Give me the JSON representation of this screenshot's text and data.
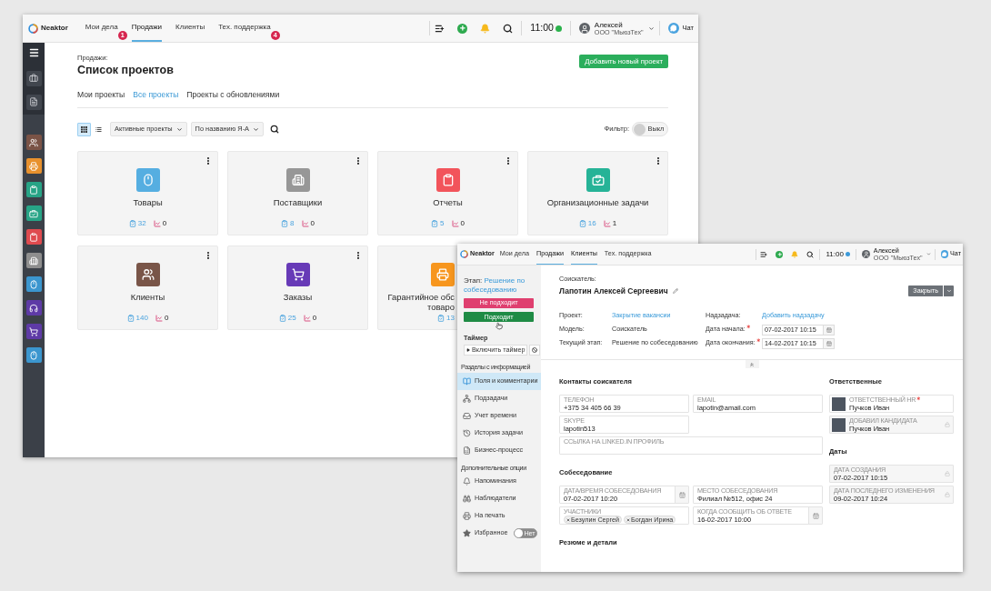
{
  "back_window": {
    "topbar": {
      "logo": "Neaktor",
      "nav": [
        {
          "label": "Мои дела",
          "selected": false,
          "badge": "1"
        },
        {
          "label": "Продажи",
          "selected": true
        },
        {
          "label": "Клиенты",
          "selected": false
        },
        {
          "label": "Тех. поддержка",
          "selected": false,
          "badge": "4"
        }
      ],
      "time": "11:00",
      "user": "Алексей",
      "company": "ООО \"МьюзТех\"",
      "chat": "Чат"
    },
    "sidebar": {
      "top": [
        {
          "kind": "menu"
        },
        {
          "kind": "briefcase"
        },
        {
          "kind": "document"
        }
      ],
      "items": [
        {
          "kind": "people",
          "color": "#7a5346"
        },
        {
          "kind": "printer",
          "color": "#e8912d"
        },
        {
          "kind": "clipboard",
          "color": "#27a486"
        },
        {
          "kind": "briefcase-check",
          "color": "#27a486"
        },
        {
          "kind": "clipboard",
          "color": "#df4a4f"
        },
        {
          "kind": "building",
          "color": "#8e8e8e"
        },
        {
          "kind": "mouse",
          "color": "#3b96cf"
        },
        {
          "kind": "headphones",
          "color": "#5e3aa6"
        },
        {
          "kind": "cart",
          "color": "#5e3aa6"
        },
        {
          "kind": "mouse",
          "color": "#3b96cf"
        }
      ]
    },
    "breadcrumb": "Продажи:",
    "title": "Список проектов",
    "add_button": "Добавить новый проект",
    "tabs": [
      {
        "label": "Мои проекты",
        "selected": false
      },
      {
        "label": "Все проекты",
        "selected": true
      },
      {
        "label": "Проекты с обновлениями",
        "selected": false
      }
    ],
    "toolbar": {
      "views": [
        {
          "kind": "grid",
          "selected": true
        },
        {
          "kind": "list",
          "selected": false
        }
      ],
      "dropdowns": [
        "Активные проекты",
        "По названию Я-А"
      ],
      "filter_label": "Фильтр:",
      "filter": {
        "label": "Выкл",
        "on": false
      }
    },
    "cards": [
      {
        "title": "Товары",
        "kind": "mouse",
        "color": "#55aee1",
        "tasks": "32",
        "updates": "0",
        "covered": false
      },
      {
        "title": "Поставщики",
        "kind": "building",
        "color": "#979797",
        "tasks": "8",
        "updates": "0",
        "covered": false
      },
      {
        "title": "Отчеты",
        "kind": "clipboard",
        "color": "#f2545b",
        "tasks": "5",
        "updates": "0",
        "covered": false
      },
      {
        "title": "Организационные задачи",
        "kind": "briefcase-check",
        "color": "#26b397",
        "tasks": "16",
        "updates": "1",
        "covered": false
      },
      {
        "title": "Клиенты",
        "kind": "people",
        "color": "#795548",
        "tasks": "140",
        "updates": "0",
        "covered": false
      },
      {
        "title": "Заказы",
        "kind": "cart",
        "color": "#673ab7",
        "tasks": "25",
        "updates": "0",
        "covered": false
      },
      {
        "title": "Гарантийное обс\nтоваро",
        "kind": "printer",
        "color": "#f7961e",
        "tasks": "13",
        "covered": true
      }
    ]
  },
  "front_window": {
    "topbar": {
      "logo": "Neaktor",
      "nav": [
        {
          "label": "Мои дела",
          "selected": false
        },
        {
          "label": "Продажи",
          "selected": true
        },
        {
          "label": "Клиенты",
          "selected": true
        },
        {
          "label": "Тех. поддержка",
          "selected": false
        }
      ],
      "time": "11:00",
      "user": "Алексей",
      "company": "ООО \"МьюзТех\"",
      "chat": "Чат"
    },
    "sidebar": {
      "stage_label": "Этап:",
      "stage": "Решение по собеседованию",
      "actions": [
        {
          "label": "Не подходит",
          "kind": "reject"
        },
        {
          "label": "Подходит",
          "kind": "accept"
        }
      ],
      "timer_label": "Таймер",
      "timer_button": "Включить таймер",
      "sections_label": "Разделы с информацией",
      "sections": [
        {
          "label": "Поля и комментарии",
          "kind": "fields",
          "selected": true
        },
        {
          "label": "Подзадачи",
          "kind": "subtasks",
          "selected": false
        },
        {
          "label": "Учет времени",
          "kind": "time",
          "selected": false
        },
        {
          "label": "История задачи",
          "kind": "history",
          "selected": false
        },
        {
          "label": "Бизнес-процесс",
          "kind": "process",
          "selected": false
        }
      ],
      "options_label": "Дополнительные опции",
      "options": [
        {
          "label": "Напоминания",
          "kind": "bell"
        },
        {
          "label": "Наблюдатели",
          "kind": "binoculars"
        },
        {
          "label": "На печать",
          "kind": "printer"
        },
        {
          "label": "Избранное",
          "kind": "star",
          "toggle": {
            "label": "Нет",
            "on": false
          }
        }
      ]
    },
    "header": {
      "label": "Соискатель:",
      "name": "Лапотин Алексей Сергеевич",
      "close_button": "Закрыть"
    },
    "properties": [
      {
        "label": "Проект:",
        "value": "Закрытие вакансии",
        "kind": "link",
        "required": false
      },
      {
        "label": "Надзадача:",
        "value": "Добавить надзадачу",
        "kind": "link",
        "required": false
      },
      {
        "label": "Модель:",
        "value": "Соискатель",
        "kind": "text",
        "required": false
      },
      {
        "label": "Дата начала:",
        "value": "07-02-2017 10:15",
        "kind": "date",
        "required": true
      },
      {
        "label": "Текущий этап:",
        "value": "Решение по собеседованию",
        "kind": "text",
        "required": false
      },
      {
        "label": "Дата окончания:",
        "value": "14-02-2017 10:15",
        "kind": "date",
        "required": true
      }
    ],
    "sections": [
      {
        "title": "Контакты соискателя",
        "fields": [
          {
            "label": "ТЕЛЕФОН",
            "value": "+375 34 405 66 39",
            "kind": "text"
          },
          {
            "label": "EMAIL",
            "value": "lapotin@amail.com",
            "kind": "text"
          },
          {
            "label": "SKYPE",
            "value": "lapotin513",
            "kind": "text"
          },
          {
            "label": "ССЫЛКА НА LINKED.IN ПРОФИЛЬ",
            "kind": "wide"
          }
        ]
      },
      {
        "title": "Собеседование",
        "fields": [
          {
            "label": "ДАТА/ВРЕМЯ СОБЕСЕДОВАНИЯ",
            "value": "07-02-2017 10:20",
            "kind": "date"
          },
          {
            "label": "МЕСТО СОБЕСЕДОВАНИЯ",
            "value": "Филиал №512, офис 24",
            "kind": "text"
          },
          {
            "label": "УЧАСТНИКИ",
            "kind": "people",
            "chips": [
              "Безулин Сергей",
              "Богдан Ирина"
            ]
          },
          {
            "label": "КОГДА СООБЩИТЬ ОБ ОТВЕТЕ",
            "value": "16-02-2017 10:00",
            "kind": "date"
          }
        ]
      },
      {
        "title": "Резюме и детали"
      }
    ],
    "side_sections": [
      {
        "title": "Ответственные",
        "fields": [
          {
            "label": "ОТВЕТСТВЕННЫЙ HR",
            "value": "Пучков Иван",
            "kind": "person",
            "required": true,
            "locked": false
          },
          {
            "label": "ДОБАВИЛ КАНДИДАТА",
            "value": "Пучков Иван",
            "kind": "person",
            "required": false,
            "locked": true
          }
        ]
      },
      {
        "title": "Даты",
        "fields": [
          {
            "label": "ДАТА СОЗДАНИЯ",
            "value": "07-02-2017 10:15",
            "kind": "text",
            "locked": true
          },
          {
            "label": "ДАТА ПОСЛЕДНЕГО ИЗМЕНЕНИЯ",
            "value": "09-02-2017 10:24",
            "kind": "text",
            "locked": true
          }
        ]
      }
    ]
  }
}
